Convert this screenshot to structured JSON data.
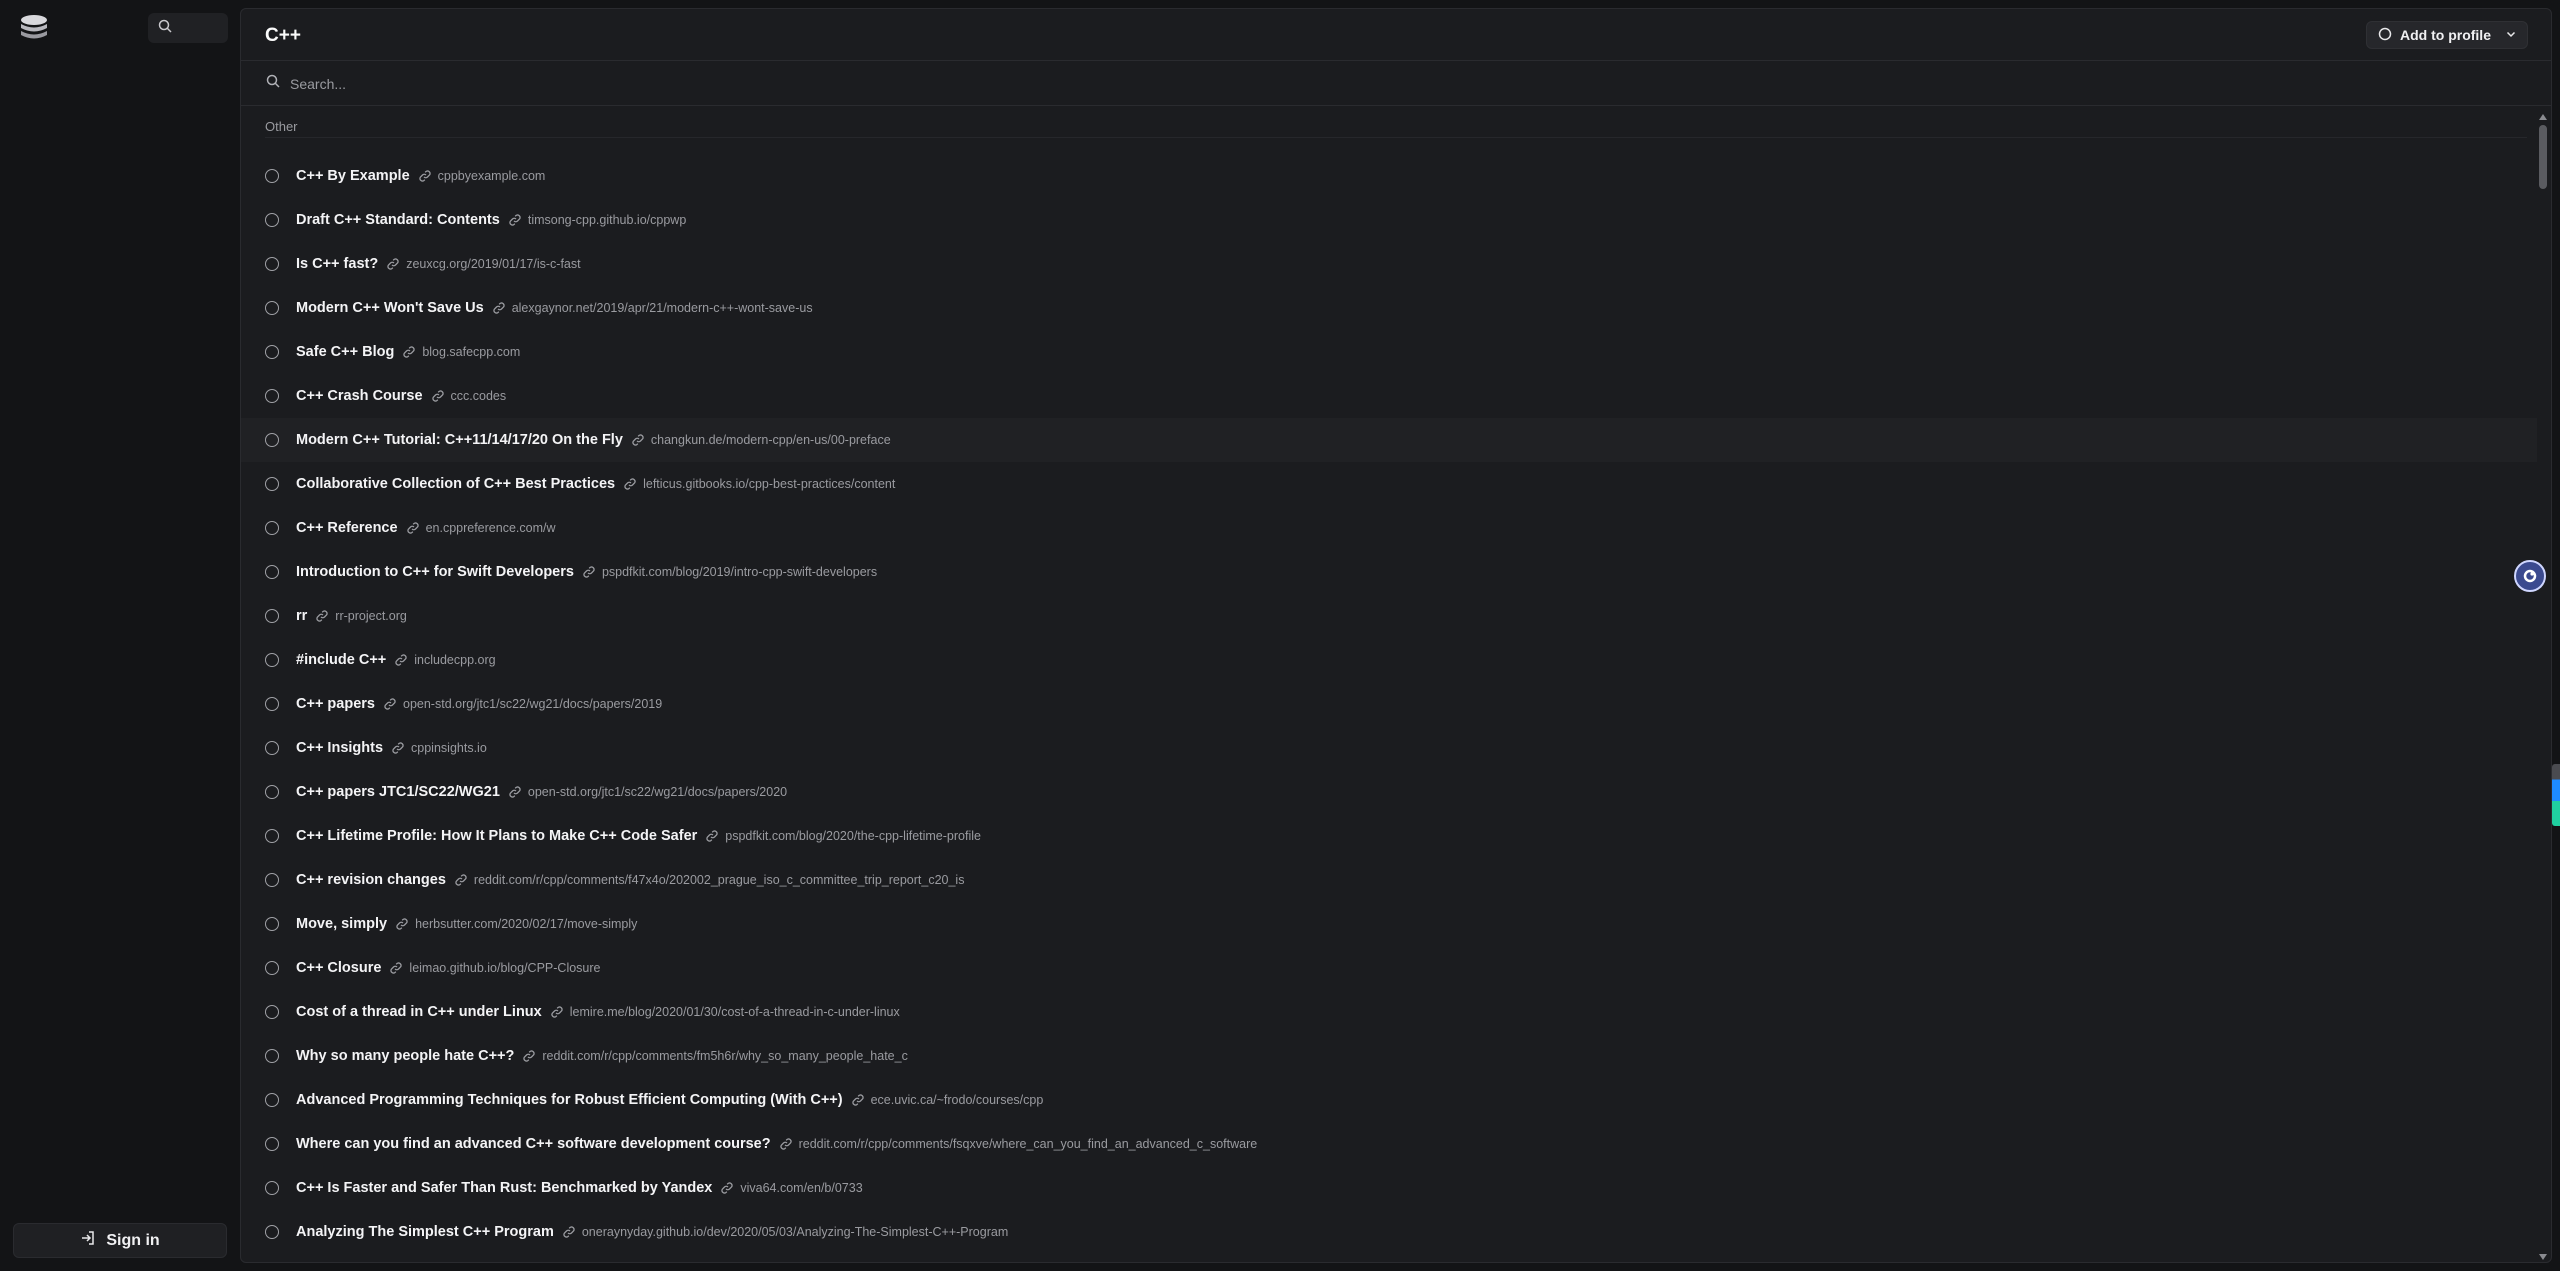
{
  "sidebar": {
    "logo_icon": "layered-logo-icon",
    "search_icon": "search-icon",
    "sign_in_label": "Sign in"
  },
  "header": {
    "title": "C++",
    "add_profile_label": "Add to profile"
  },
  "search": {
    "placeholder": "Search..."
  },
  "section": {
    "label": "Other"
  },
  "items": [
    {
      "title": "C++ By Example",
      "url": "cppbyexample.com"
    },
    {
      "title": "Draft C++ Standard: Contents",
      "url": "timsong-cpp.github.io/cppwp"
    },
    {
      "title": "Is C++ fast?",
      "url": "zeuxcg.org/2019/01/17/is-c-fast"
    },
    {
      "title": "Modern C++ Won't Save Us",
      "url": "alexgaynor.net/2019/apr/21/modern-c++-wont-save-us"
    },
    {
      "title": "Safe C++ Blog",
      "url": "blog.safecpp.com"
    },
    {
      "title": "C++ Crash Course",
      "url": "ccc.codes"
    },
    {
      "title": "Modern C++ Tutorial: C++11/14/17/20 On the Fly",
      "url": "changkun.de/modern-cpp/en-us/00-preface"
    },
    {
      "title": "Collaborative Collection of C++ Best Practices",
      "url": "lefticus.gitbooks.io/cpp-best-practices/content"
    },
    {
      "title": "C++ Reference",
      "url": "en.cppreference.com/w"
    },
    {
      "title": "Introduction to C++ for Swift Developers",
      "url": "pspdfkit.com/blog/2019/intro-cpp-swift-developers"
    },
    {
      "title": "rr",
      "url": "rr-project.org"
    },
    {
      "title": "#include C++",
      "url": "includecpp.org"
    },
    {
      "title": "C++ papers",
      "url": "open-std.org/jtc1/sc22/wg21/docs/papers/2019"
    },
    {
      "title": "C++ Insights",
      "url": "cppinsights.io"
    },
    {
      "title": "C++ papers JTC1/SC22/WG21",
      "url": "open-std.org/jtc1/sc22/wg21/docs/papers/2020"
    },
    {
      "title": "C++ Lifetime Profile: How It Plans to Make C++ Code Safer",
      "url": "pspdfkit.com/blog/2020/the-cpp-lifetime-profile"
    },
    {
      "title": "C++ revision changes",
      "url": "reddit.com/r/cpp/comments/f47x4o/202002_prague_iso_c_committee_trip_report_c20_is"
    },
    {
      "title": "Move, simply",
      "url": "herbsutter.com/2020/02/17/move-simply"
    },
    {
      "title": "C++ Closure",
      "url": "leimao.github.io/blog/CPP-Closure"
    },
    {
      "title": "Cost of a thread in C++ under Linux",
      "url": "lemire.me/blog/2020/01/30/cost-of-a-thread-in-c-under-linux"
    },
    {
      "title": "Why so many people hate C++?",
      "url": "reddit.com/r/cpp/comments/fm5h6r/why_so_many_people_hate_c"
    },
    {
      "title": "Advanced Programming Techniques for Robust Efficient Computing (With C++)",
      "url": "ece.uvic.ca/~frodo/courses/cpp"
    },
    {
      "title": "Where can you find an advanced C++ software development course?",
      "url": "reddit.com/r/cpp/comments/fsqxve/where_can_you_find_an_advanced_c_software"
    },
    {
      "title": "C++ Is Faster and Safer Than Rust: Benchmarked by Yandex",
      "url": "viva64.com/en/b/0733"
    },
    {
      "title": "Analyzing The Simplest C++ Program",
      "url": "oneraynyday.github.io/dev/2020/05/03/Analyzing-The-Simplest-C++-Program"
    }
  ],
  "hovered_index": 6
}
